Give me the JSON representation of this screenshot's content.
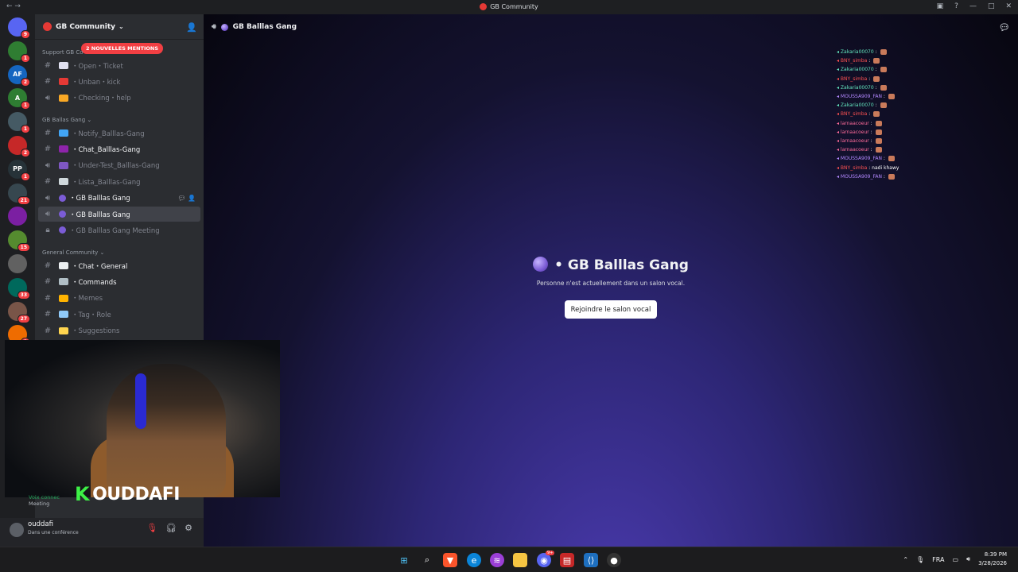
{
  "window": {
    "title": "GB Community"
  },
  "servers": [
    {
      "label": "",
      "badge": "9",
      "color": "#5865f2"
    },
    {
      "label": "",
      "badge": "1",
      "color": "#2f7d32"
    },
    {
      "label": "AF",
      "badge": "2",
      "color": "#1565c0"
    },
    {
      "label": "A",
      "badge": "1",
      "color": "#2e7d32"
    },
    {
      "label": "",
      "badge": "1",
      "color": "#455a64"
    },
    {
      "label": "",
      "badge": "2",
      "color": "#c62828"
    },
    {
      "label": "PP",
      "badge": "1",
      "color": "#263238"
    },
    {
      "label": "",
      "badge": "21",
      "color": "#37474f"
    },
    {
      "label": "",
      "badge": "",
      "color": "#7b1fa2"
    },
    {
      "label": "",
      "badge": "15",
      "color": "#558b2f"
    },
    {
      "label": "",
      "badge": "",
      "color": "#616161"
    },
    {
      "label": "",
      "badge": "33",
      "color": "#00695c"
    },
    {
      "label": "",
      "badge": "27",
      "color": "#795548"
    },
    {
      "label": "",
      "badge": "3",
      "color": "#ef6c00"
    }
  ],
  "sidebar": {
    "server_name": "GB Community",
    "mentions_pill": "2 NOUVELLES MENTIONS",
    "category_support": "Support GB Co",
    "category_ballas": "GB Ballas Gang",
    "category_general": "General Community",
    "support_channels": [
      {
        "label": "Open・Ticket",
        "icon": "envelope-icon",
        "type": "text",
        "emo": "#e0e0f0"
      },
      {
        "label": "Unban・kick",
        "icon": "no-entry-icon",
        "type": "text",
        "emo": "#e53935"
      },
      {
        "label": "Checking・help",
        "icon": "gift-icon",
        "type": "voice",
        "emo": "#f9a825"
      }
    ],
    "ballas_channels": [
      {
        "label": "Notify_Balllas-Gang",
        "icon": "book-icon",
        "type": "text",
        "emo": "#42a5f5",
        "state": ""
      },
      {
        "label": "Chat_Balllas-Gang",
        "icon": "game-icon",
        "type": "text",
        "emo": "#8e24aa",
        "state": "bright"
      },
      {
        "label": "Under-Test_Balllas-Gang",
        "icon": "sparkle-icon",
        "type": "voice",
        "emo": "#7e57c2",
        "state": ""
      },
      {
        "label": "Lista_Balllas-Gang",
        "icon": "scroll-icon",
        "type": "text",
        "emo": "#cfd8dc",
        "state": ""
      },
      {
        "label": "GB Balllas Gang",
        "icon": "orb-icon",
        "type": "voice",
        "emo": "#7b5cd6",
        "state": "hover"
      },
      {
        "label": "GB Balllas Gang",
        "icon": "orb-icon",
        "type": "voice",
        "emo": "#7b5cd6",
        "state": "sel"
      },
      {
        "label": "GB Balllas Gang Meeting",
        "icon": "orb-icon",
        "type": "lock",
        "emo": "#7b5cd6",
        "state": ""
      }
    ],
    "general_channels": [
      {
        "label": "Chat・General",
        "icon": "speech-icon",
        "type": "text",
        "emo": "#eceff1",
        "state": "bright"
      },
      {
        "label": "Commands",
        "icon": "robot-icon",
        "type": "text",
        "emo": "#b0bec5",
        "state": "bright"
      },
      {
        "label": "Memes",
        "icon": "laugh-icon",
        "type": "text",
        "emo": "#ffb300",
        "state": ""
      },
      {
        "label": "Tag・Role",
        "icon": "magnifier-icon",
        "type": "text",
        "emo": "#90caf9",
        "state": ""
      },
      {
        "label": "Suggestions",
        "icon": "bulb-icon",
        "type": "text",
        "emo": "#ffd54f",
        "state": ""
      }
    ]
  },
  "main": {
    "header_title": "GB Balllas Gang",
    "center_title": "GB Balllas Gang",
    "center_subtitle": "Personne n'est actuellement dans un salon vocal.",
    "join_button": "Rejoindre le salon vocal"
  },
  "chat_overlay": [
    {
      "user": "Zakaria00070",
      "color": "#63e6be"
    },
    {
      "user": "BNY_simba",
      "color": "#ff5252"
    },
    {
      "user": "Zakaria00070",
      "color": "#63e6be"
    },
    {
      "user": "BNY_simba",
      "color": "#ff5252"
    },
    {
      "user": "Zakaria00070",
      "color": "#63e6be"
    },
    {
      "user": "MOUSSA909_FAN",
      "color": "#b388ff"
    },
    {
      "user": "Zakaria00070",
      "color": "#63e6be"
    },
    {
      "user": "BNY_simba",
      "color": "#ff5252"
    },
    {
      "user": "larnaacoeur",
      "color": "#ff6b9a"
    },
    {
      "user": "larnaacoeur",
      "color": "#ff6b9a"
    },
    {
      "user": "larnaacoeur",
      "color": "#ff6b9a"
    },
    {
      "user": "larnaacoeur",
      "color": "#ff6b9a"
    },
    {
      "user": "MOUSSA909_FAN",
      "color": "#b388ff"
    },
    {
      "user": "BNY_simba",
      "color": "#ff5252",
      "msg": "nadi khawy"
    },
    {
      "user": "MOUSSA909_FAN",
      "color": "#b388ff"
    }
  ],
  "voice_bar": {
    "line1": "Voix connec",
    "line2": "Meeting"
  },
  "user": {
    "name": "ouddafi",
    "status": "Dans une conférence"
  },
  "stream_brand": {
    "k": "K",
    "name": "OUDDAFI"
  },
  "taskbar": {
    "lang": "FRA",
    "time": "8:39 PM",
    "date": "3/28/2026",
    "discord_badge": "9+"
  }
}
